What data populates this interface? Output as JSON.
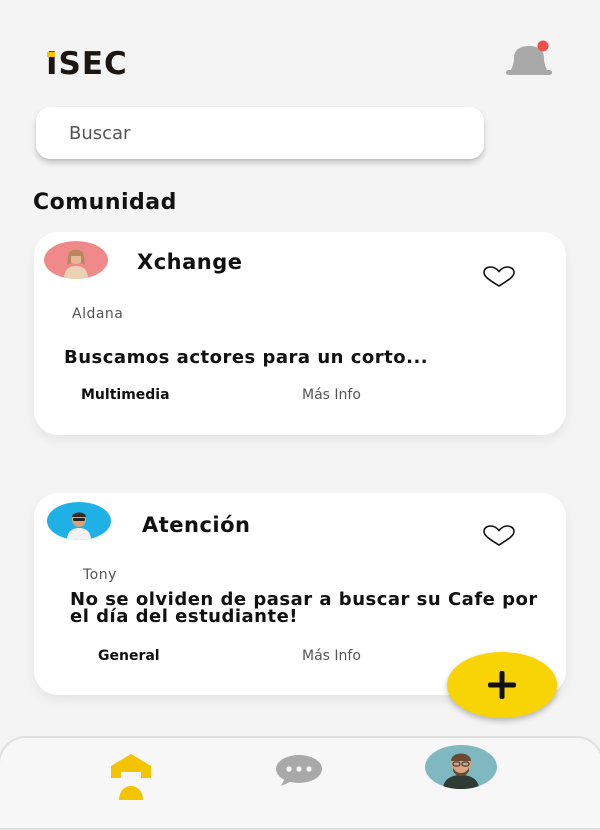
{
  "header": {
    "logo_text": "ISEC",
    "brand_color": "#f5c400"
  },
  "search": {
    "placeholder": "Buscar"
  },
  "section": {
    "title": "Comunidad"
  },
  "posts": [
    {
      "title": "Xchange",
      "author": "Aldana",
      "body": "Buscamos actores para un corto...",
      "category": "Multimedia",
      "more_label": "Más Info",
      "liked": false
    },
    {
      "title": "Atención",
      "author": "Tony",
      "body": "No se olviden de pasar a buscar su Cafe por el día del estudiante!",
      "category": "General",
      "more_label": "Más Info",
      "liked": false
    }
  ],
  "fab": {
    "icon": "plus-icon",
    "color": "#f8d404"
  },
  "notification": {
    "has_unread": true,
    "dot_color": "#f0504a"
  },
  "bottom_nav": {
    "items": [
      {
        "icon": "home-icon",
        "active": true
      },
      {
        "icon": "chat-icon",
        "active": false
      },
      {
        "icon": "profile-avatar",
        "active": false
      }
    ]
  }
}
